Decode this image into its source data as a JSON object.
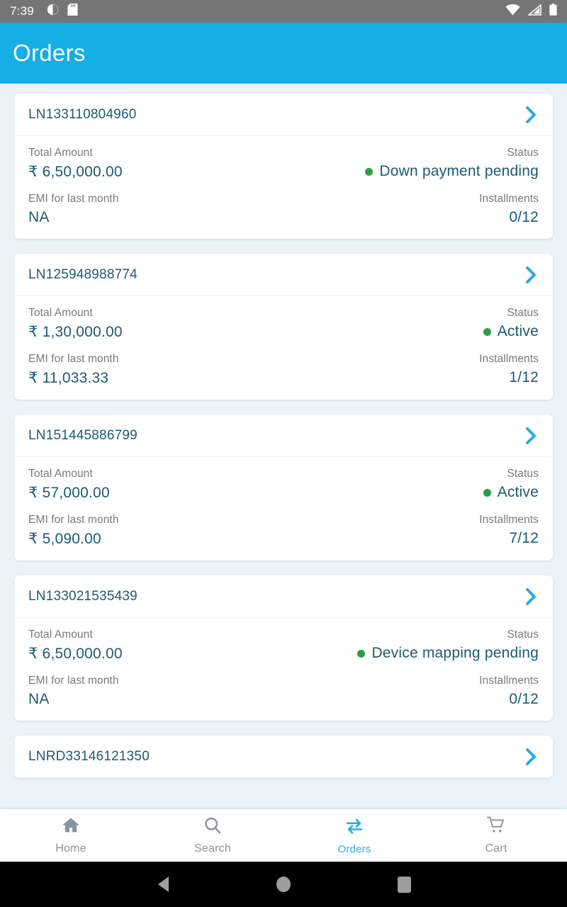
{
  "status_bar": {
    "clock": "7:39",
    "left_icons": [
      "screen-record-icon",
      "sd-card-icon"
    ],
    "right_icons": [
      "wifi-icon",
      "cellular-signal-icon",
      "battery-icon"
    ]
  },
  "app_bar": {
    "title": "Orders"
  },
  "colors": {
    "accent_blue": "#15aee5",
    "chevron_blue": "#29abe2",
    "value_navy": "#1b5a75",
    "label_gray": "#757b7e",
    "status_green": "#2e9e44",
    "page_background": "#eaf4f8",
    "card_background": "#ffffff"
  },
  "labels": {
    "total_amount": "Total Amount",
    "status": "Status",
    "emi_last_month": "EMI for last month",
    "installments": "Installments"
  },
  "orders": [
    {
      "loan_id": "LN133110804960",
      "total_amount": "₹ 6,50,000.00",
      "status": "Down payment pending",
      "emi": "NA",
      "installments": "0/12"
    },
    {
      "loan_id": "LN125948988774",
      "total_amount": "₹ 1,30,000.00",
      "status": "Active",
      "emi": "₹ 11,033.33",
      "installments": "1/12"
    },
    {
      "loan_id": "LN151445886799",
      "total_amount": "₹ 57,000.00",
      "status": "Active",
      "emi": "₹ 5,090.00",
      "installments": "7/12"
    },
    {
      "loan_id": "LN133021535439",
      "total_amount": "₹ 6,50,000.00",
      "status": "Device mapping pending",
      "emi": "NA",
      "installments": "0/12"
    },
    {
      "loan_id": "LNRD33146121350",
      "total_amount": "",
      "status": "",
      "emi": "",
      "installments": ""
    }
  ],
  "bottom_nav": {
    "items": [
      {
        "label": "Home",
        "icon": "home-icon",
        "active": false
      },
      {
        "label": "Search",
        "icon": "search-icon",
        "active": false
      },
      {
        "label": "Orders",
        "icon": "exchange-arrows-icon",
        "active": true
      },
      {
        "label": "Cart",
        "icon": "shopping-cart-icon",
        "active": false
      }
    ]
  },
  "android_nav": {
    "back": "back-triangle-icon",
    "home": "home-circle-icon",
    "recents": "recents-square-icon"
  }
}
